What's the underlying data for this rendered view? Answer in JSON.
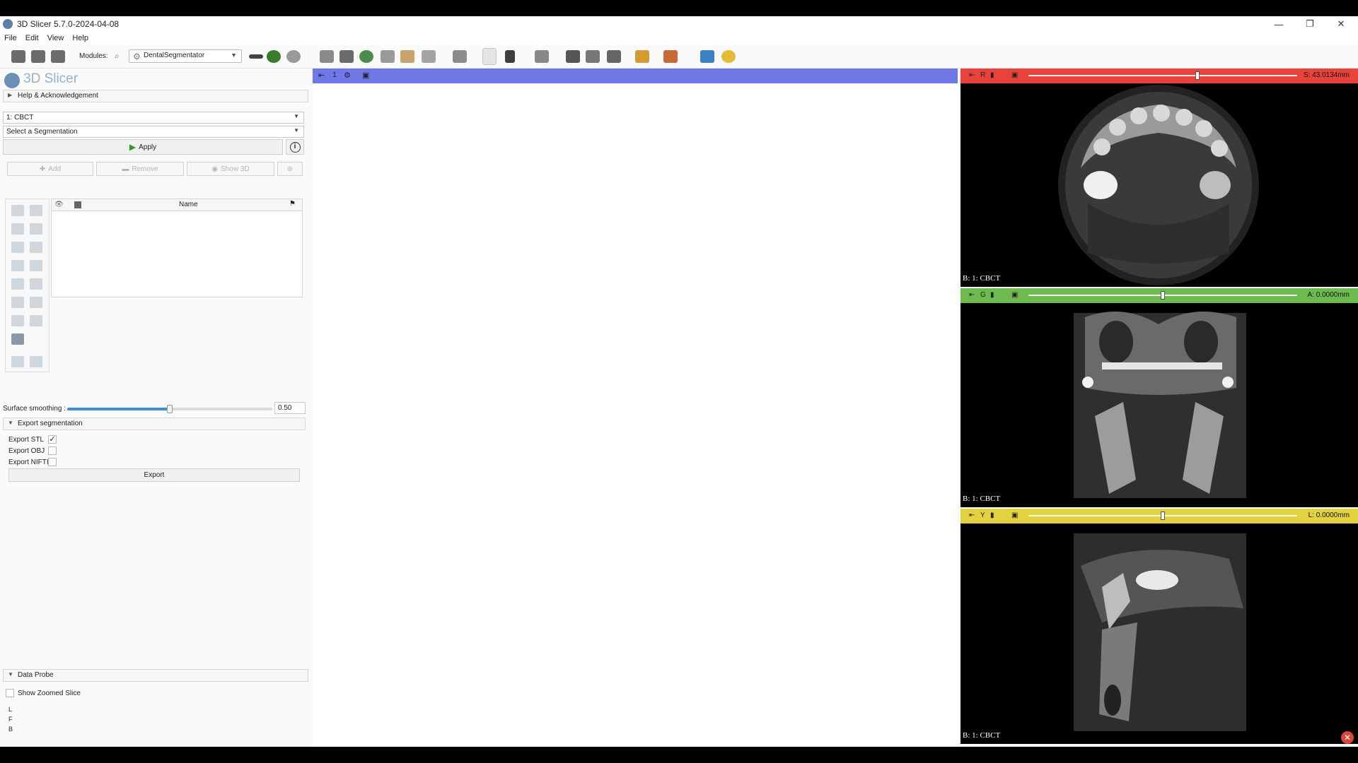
{
  "window": {
    "title": "3D Slicer 5.7.0-2024-04-08",
    "minimize": "—",
    "restore": "❐",
    "close": "✕"
  },
  "menu": [
    "File",
    "Edit",
    "View",
    "Help"
  ],
  "toolbar": {
    "modules_label": "Modules:",
    "module_selected": "DentalSegmentator"
  },
  "panel": {
    "app_name": "3D Slicer",
    "help_section": "Help & Acknowledgement",
    "input_volume": "1: CBCT",
    "segmentation_placeholder": "Select a Segmentation",
    "apply_label": "Apply",
    "info_glyph": "i",
    "add_label": "Add",
    "remove_label": "Remove",
    "show3d_label": "Show 3D",
    "table_name_header": "Name",
    "surface_smoothing_label": "Surface smoothing :",
    "surface_smoothing_value": "0.50",
    "surface_smoothing_fraction": 0.5,
    "export_section": "Export segmentation",
    "export_stl_label": "Export STL",
    "export_stl_checked": true,
    "export_obj_label": "Export OBJ",
    "export_obj_checked": false,
    "export_nifti_label": "Export NIFTI",
    "export_nifti_checked": false,
    "export_button": "Export",
    "data_probe_section": "Data Probe",
    "show_zoomed_slice_label": "Show Zoomed Slice",
    "probe_l": "L",
    "probe_f": "F",
    "probe_b": "B"
  },
  "view3d": {
    "view_label": "1"
  },
  "slices": [
    {
      "letter": "R",
      "offset": "S: 43.0134mm",
      "volume": "B: 1: CBCT",
      "color": "#e8423a",
      "knob_fraction": 0.63
    },
    {
      "letter": "G",
      "offset": "A: 0.0000mm",
      "volume": "B: 1: CBCT",
      "color": "#6dbb4f",
      "knob_fraction": 0.5
    },
    {
      "letter": "Y",
      "offset": "L: 0.0000mm",
      "volume": "B: 1: CBCT",
      "color": "#e3d23f",
      "knob_fraction": 0.5
    }
  ]
}
